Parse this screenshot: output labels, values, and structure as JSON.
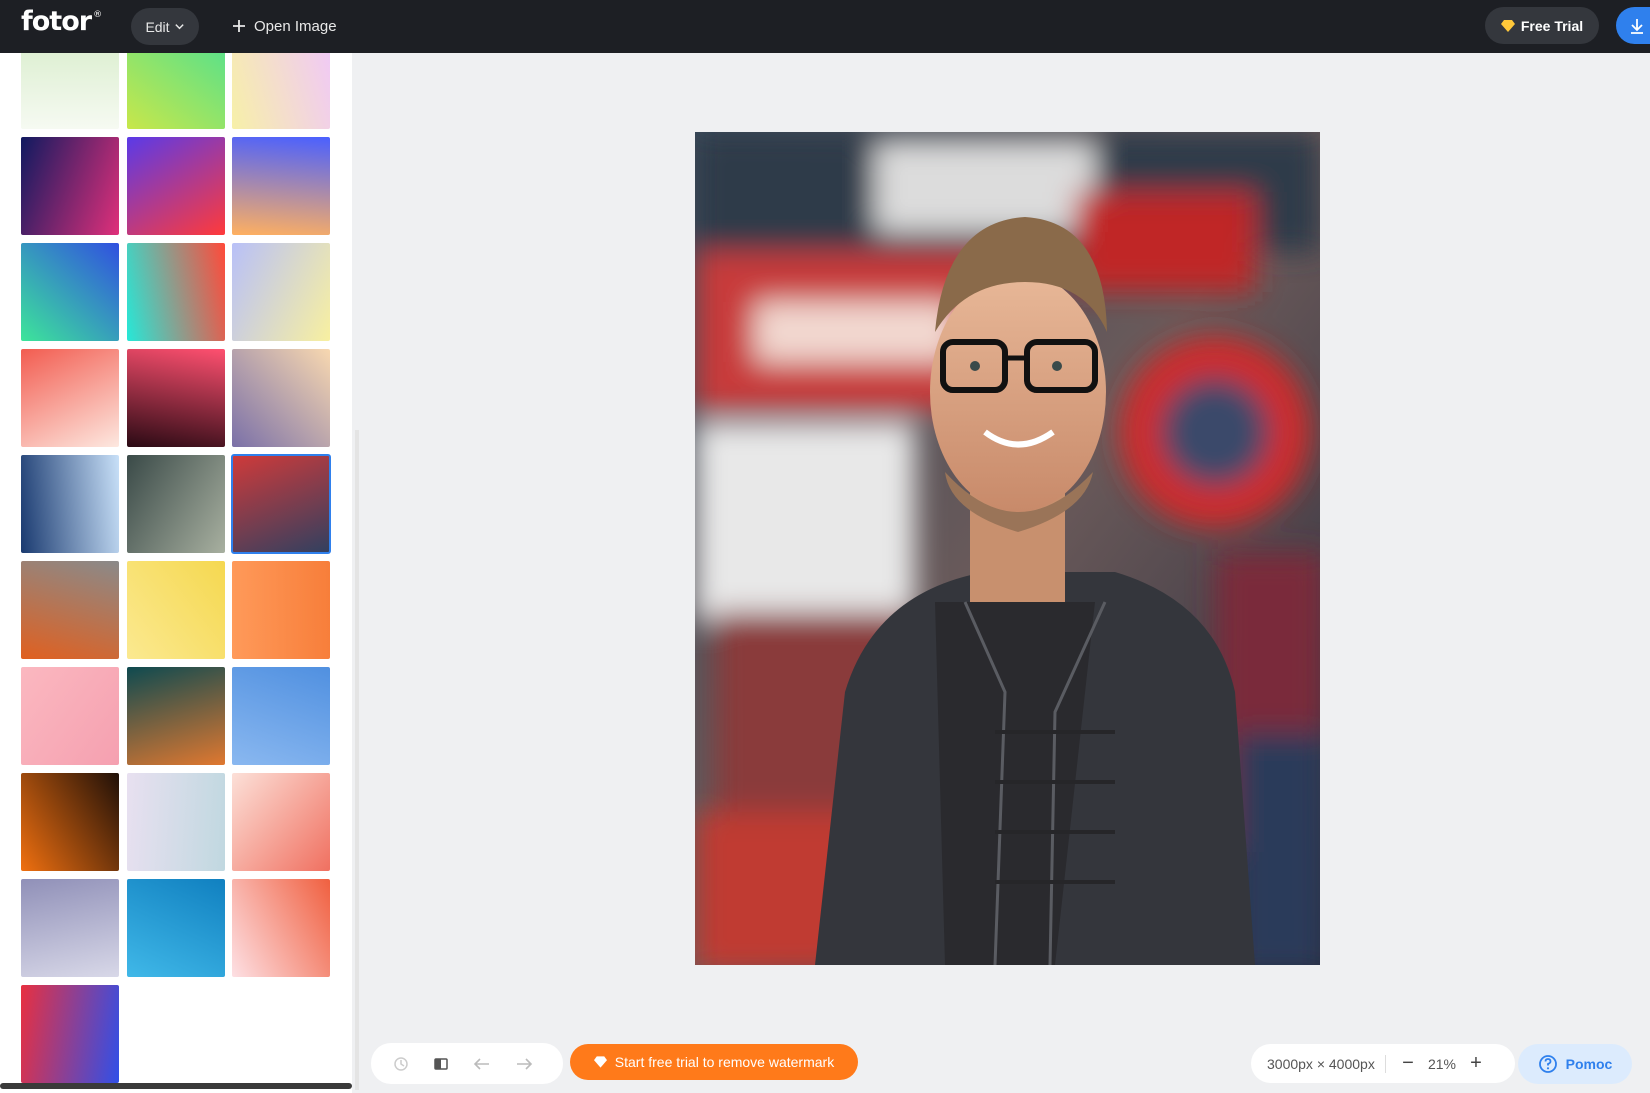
{
  "header": {
    "logo": "fotor",
    "logo_mark": "®",
    "edit_label": "Edit",
    "open_image_label": "Open Image",
    "free_trial_label": "Free Trial"
  },
  "sidebar": {
    "tiles": [
      {
        "name": "background-tile-mint-gradient",
        "colors": [
          "#f6faf2",
          "#d8edcb"
        ]
      },
      {
        "name": "background-tile-green-yellow-gradient",
        "colors": [
          "#c8e74a",
          "#4fe090"
        ]
      },
      {
        "name": "background-tile-pastel-rainbow-gradient",
        "colors": [
          "#f7f0a8",
          "#f0c8f8"
        ]
      },
      {
        "name": "background-tile-navy-pink-gradient",
        "colors": [
          "#101a60",
          "#e0307a"
        ]
      },
      {
        "name": "background-tile-blue-red-gradient",
        "colors": [
          "#5a3ae8",
          "#ff3a3a"
        ]
      },
      {
        "name": "background-tile-orange-blue-gradient",
        "colors": [
          "#ffb060",
          "#4a60ff"
        ]
      },
      {
        "name": "background-tile-green-blue-gradient",
        "colors": [
          "#3de59a",
          "#3050e0"
        ]
      },
      {
        "name": "background-tile-cyan-red-gradient",
        "colors": [
          "#26e8d8",
          "#ff4a3a"
        ]
      },
      {
        "name": "background-tile-lavender-yellow-gradient",
        "colors": [
          "#b8c0f8",
          "#f8f0a0"
        ]
      },
      {
        "name": "background-tile-coral-gradient",
        "colors": [
          "#f25c50",
          "#fde8e0"
        ]
      },
      {
        "name": "background-tile-dark-bokeh",
        "colors": [
          "#2a0a14",
          "#ff5070"
        ]
      },
      {
        "name": "background-tile-gold-bokeh",
        "colors": [
          "#7a70a8",
          "#f8d8b0"
        ]
      },
      {
        "name": "background-tile-blue-bokeh",
        "colors": [
          "#1a3a70",
          "#c8e0f8"
        ]
      },
      {
        "name": "background-tile-graffiti-wall",
        "colors": [
          "#3a4a48",
          "#a8b0a0"
        ]
      },
      {
        "name": "background-tile-graffiti-street",
        "colors": [
          "#d03a3a",
          "#304060"
        ]
      },
      {
        "name": "background-tile-orange-wall",
        "colors": [
          "#e06020",
          "#8a8a8a"
        ]
      },
      {
        "name": "background-tile-yellow-paint",
        "colors": [
          "#fbe990",
          "#f5d850"
        ]
      },
      {
        "name": "background-tile-orange-paint",
        "colors": [
          "#ff9a5a",
          "#f77e3a"
        ]
      },
      {
        "name": "background-tile-pink-watercolor",
        "colors": [
          "#fbb8c0",
          "#f5a0b0"
        ]
      },
      {
        "name": "background-tile-teal-marble",
        "colors": [
          "#0e4a50",
          "#e07830"
        ]
      },
      {
        "name": "background-tile-blue-marble",
        "colors": [
          "#8ab8f0",
          "#5090e0"
        ]
      },
      {
        "name": "background-tile-orange-marble",
        "colors": [
          "#f07010",
          "#201008"
        ]
      },
      {
        "name": "background-tile-holographic",
        "colors": [
          "#e8e0f0",
          "#c0d8e0"
        ]
      },
      {
        "name": "background-tile-peach-marble",
        "colors": [
          "#fce0d8",
          "#f07060"
        ]
      },
      {
        "name": "background-tile-purple-marble",
        "colors": [
          "#9090b8",
          "#d8d8e8"
        ]
      },
      {
        "name": "background-tile-pool-water",
        "colors": [
          "#40b8e8",
          "#1080c0"
        ]
      },
      {
        "name": "background-tile-confetti",
        "colors": [
          "#fde0e4",
          "#f06040"
        ]
      },
      {
        "name": "background-tile-red-blue-brush",
        "colors": [
          "#e83040",
          "#3050e8"
        ]
      }
    ]
  },
  "canvas": {
    "image_name": "portrait-photo"
  },
  "bottom": {
    "watermark_label": "Start free trial to remove watermark",
    "dimensions": "3000px × 4000px",
    "zoom": "21%",
    "help_label": "Pomoc"
  },
  "colors": {
    "accent_blue": "#2f80ed",
    "accent_orange": "#ff7a1a",
    "topbar_bg": "#1d1f24"
  }
}
